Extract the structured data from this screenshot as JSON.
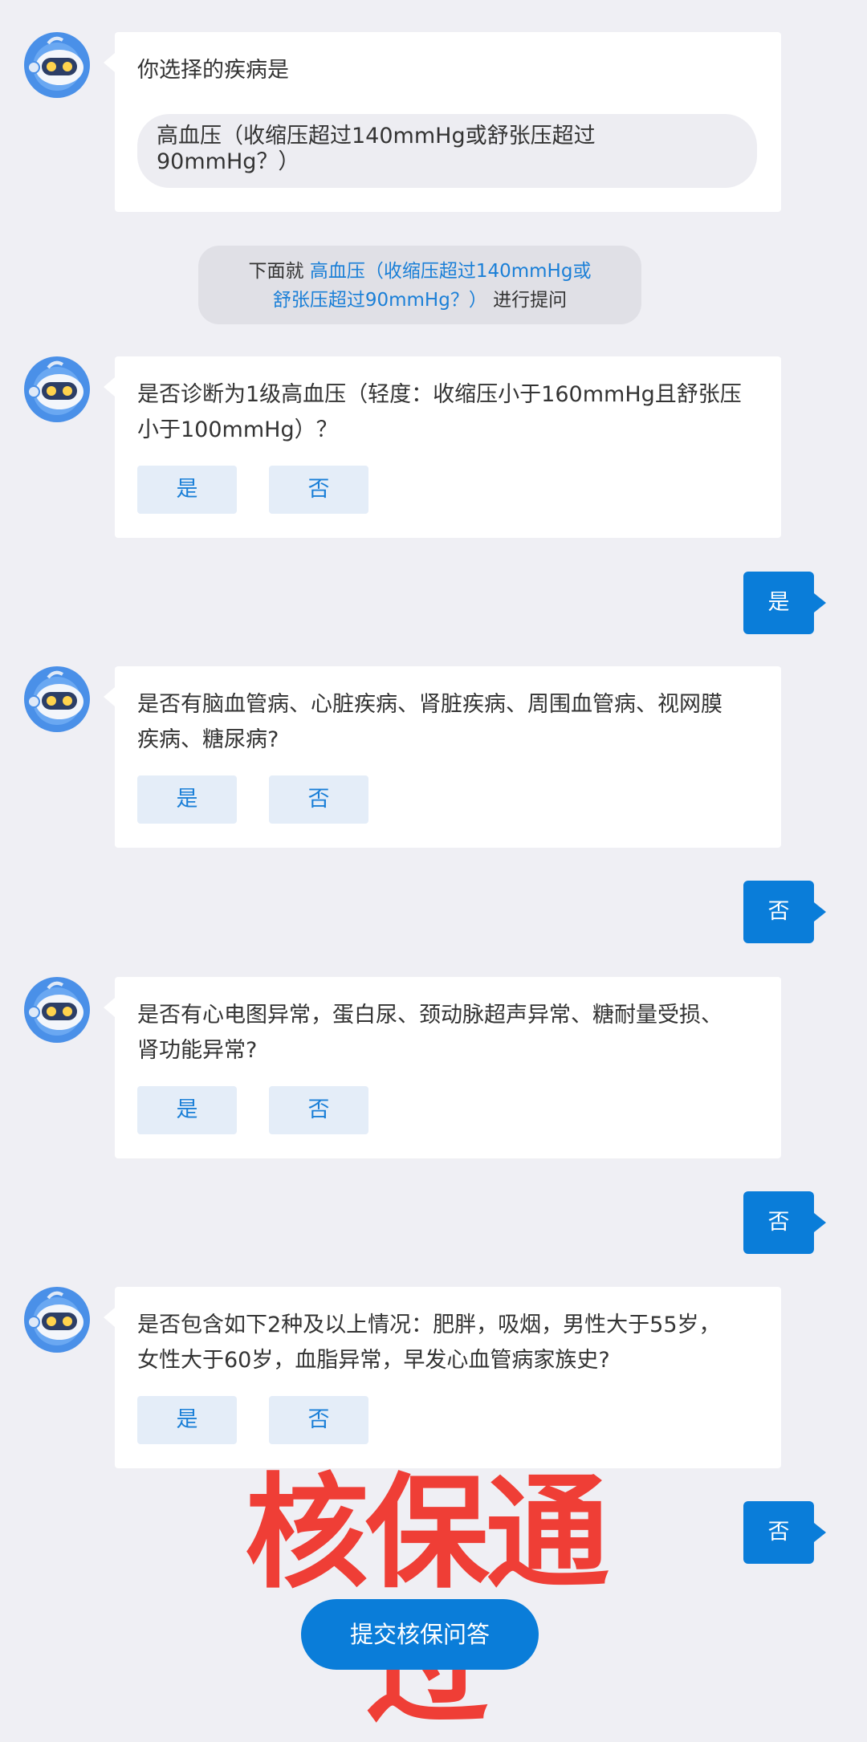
{
  "intro": {
    "title": "你选择的疾病是",
    "disease_line1": "高血压（收缩压超过140mmHg或舒张压超过",
    "disease_line2": "90mmHg？）"
  },
  "notice": {
    "prefix": "下面就",
    "highlight_line1": "高血压（收缩压超过140mmHg或",
    "highlight_line2": "舒张压超过90mmHg？）",
    "suffix": "进行提问"
  },
  "questions": [
    {
      "line1": "是否诊断为1级高血压（轻度：收缩压小于160mmHg且舒张压",
      "line2": "小于100mmHg）？",
      "yes": "是",
      "no": "否",
      "answer": "是"
    },
    {
      "line1": "是否有脑血管病、心脏疾病、肾脏疾病、周围血管病、视网膜",
      "line2": "疾病、糖尿病?",
      "yes": "是",
      "no": "否",
      "answer": "否"
    },
    {
      "line1": "是否有心电图异常，蛋白尿、颈动脉超声异常、糖耐量受损、",
      "line2": "肾功能异常?",
      "yes": "是",
      "no": "否",
      "answer": "否"
    },
    {
      "line1": "是否包含如下2种及以上情况：肥胖，吸烟，男性大于55岁，",
      "line2": "女性大于60岁，血脂异常，早发心血管病家族史?",
      "yes": "是",
      "no": "否",
      "answer": "否"
    }
  ],
  "stamp": "核保通过",
  "submit_label": "提交核保问答",
  "colors": {
    "accent": "#0a7dd9",
    "stamp": "#ef3e36",
    "background": "#efeff4"
  }
}
